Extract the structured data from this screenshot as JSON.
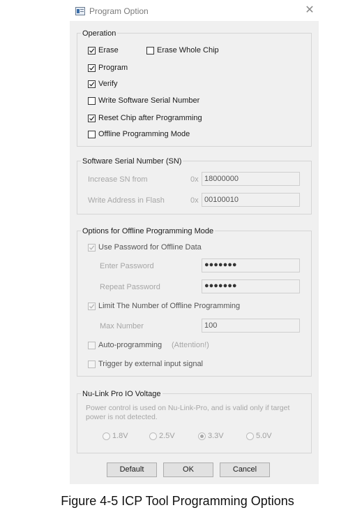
{
  "window": {
    "title": "Program Option",
    "close_label": "✕"
  },
  "operation": {
    "title": "Operation",
    "items": [
      {
        "label": "Erase",
        "checked": true
      },
      {
        "label": "Erase Whole Chip",
        "checked": false
      },
      {
        "label": "Program",
        "checked": true
      },
      {
        "label": "Verify",
        "checked": true
      },
      {
        "label": "Write Software Serial Number",
        "checked": false
      },
      {
        "label": "Reset Chip after Programming",
        "checked": true
      },
      {
        "label": "Offline Programming Mode",
        "checked": false
      }
    ]
  },
  "serial": {
    "title": "Software Serial Number (SN)",
    "increase_label": "Increase SN from",
    "increase_prefix": "0x",
    "increase_value": "18000000",
    "address_label": "Write Address in Flash",
    "address_prefix": "0x",
    "address_value": "00100010"
  },
  "offline": {
    "title": "Options for Offline Programming Mode",
    "use_password_label": "Use Password for Offline Data",
    "enter_password_label": "Enter Password",
    "enter_password_value": "●●●●●●●",
    "repeat_password_label": "Repeat Password",
    "repeat_password_value": "●●●●●●●",
    "limit_label": "Limit The Number of Offline Programming",
    "max_number_label": "Max Number",
    "max_number_value": "100",
    "auto_label": "Auto-programming",
    "attention_label": "(Attention!)",
    "trigger_label": "Trigger by external input signal"
  },
  "voltage": {
    "title": "Nu-Link Pro IO Voltage",
    "note_line1": "Power control is used on Nu-Link-Pro, and is valid only if target",
    "note_line2": "power is not detected.",
    "options": [
      "1.8V",
      "2.5V",
      "3.3V",
      "5.0V"
    ],
    "selected": "3.3V"
  },
  "buttons": {
    "default": "Default",
    "ok": "OK",
    "cancel": "Cancel"
  },
  "caption": "Figure 4-5 ICP Tool Programming Options"
}
